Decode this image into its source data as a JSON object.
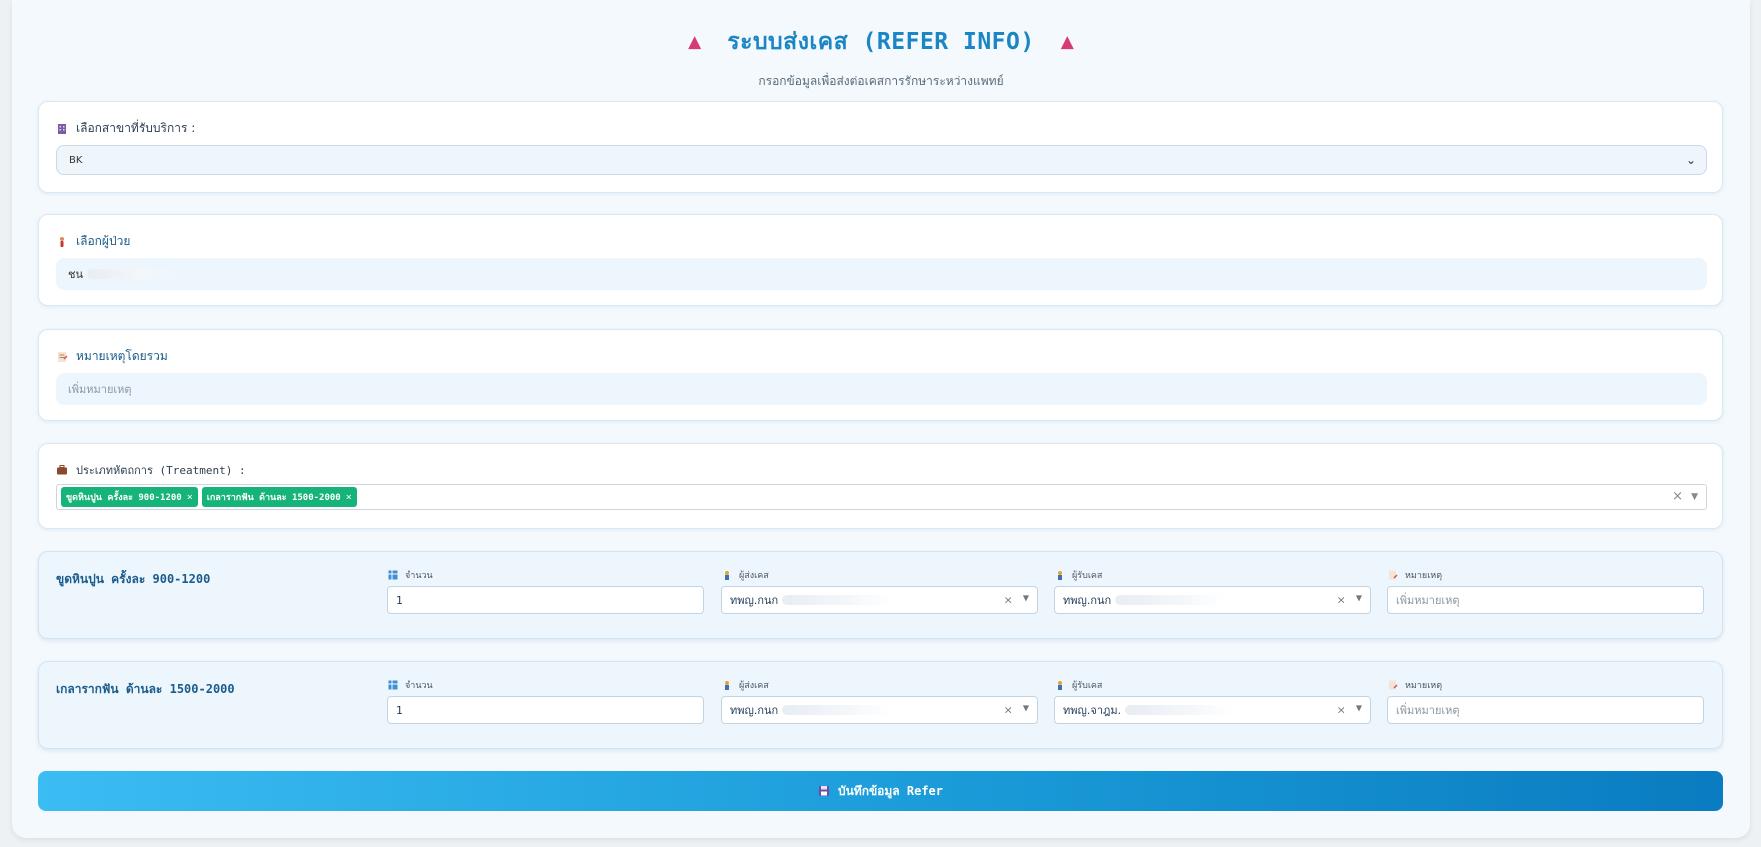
{
  "header": {
    "title": "ระบบส่งเคส (REFER INFO)",
    "subtitle": "กรอกข้อมูลเพื่อส่งต่อเคสการรักษาระหว่างแพทย์"
  },
  "branch": {
    "label": "เลือกสาขาที่รับบริการ :",
    "icon": "building-icon",
    "selected": "BK"
  },
  "patient": {
    "label": "เลือกผู้ป่วย",
    "icon": "person-icon",
    "value": "ชน"
  },
  "note": {
    "label": "หมายเหตุโดยรวม",
    "icon": "memo-icon",
    "placeholder": "เพิ่มหมายเหตุ"
  },
  "treatment_type": {
    "label": "ประเภทหัตถการ (Treatment) :",
    "icon": "briefcase-icon",
    "tags": [
      {
        "label": "ขูดหินปูน ครั้งละ 900-1200"
      },
      {
        "label": "เกลารากฟัน ด้านละ 1500-2000"
      }
    ]
  },
  "field_labels": {
    "quantity": "จำนวน",
    "sender": "ผู้ส่งเคส",
    "receiver": "ผู้รับเคส",
    "remark": "หมายเหตุ",
    "remark_placeholder": "เพิ่มหมายเหตุ"
  },
  "treatments": [
    {
      "name": "ขูดหินปูน ครั้งละ 900-1200",
      "quantity": "1",
      "sender": "ทพญ.กนก",
      "receiver": "ทพญ.กนก"
    },
    {
      "name": "เกลารากฟัน ด้านละ 1500-2000",
      "quantity": "1",
      "sender": "ทพญ.กนก",
      "receiver": "ทพญ.จาฎม."
    }
  ],
  "submit": {
    "label": "บันทึกข้อมูล Refer",
    "icon": "floppy-disk-icon"
  },
  "colors": {
    "accent": "#1b86c4",
    "tag": "#16b37a",
    "triangle": "#d63a78"
  }
}
